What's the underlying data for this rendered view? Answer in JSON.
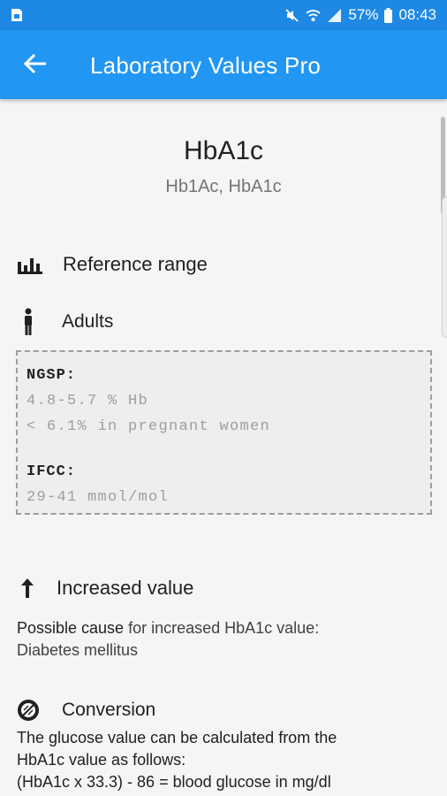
{
  "status_bar": {
    "battery": "57%",
    "time": "08:43",
    "icons": [
      "sim-icon",
      "mute-icon",
      "wifi-icon",
      "signal-icon",
      "battery-icon"
    ]
  },
  "app_bar": {
    "title": "Laboratory Values Pro",
    "back_icon": "arrow-back-icon"
  },
  "test": {
    "name": "HbA1c",
    "aliases": "Hb1Ac, HbA1c"
  },
  "reference": {
    "heading": "Reference range",
    "group_label": "Adults",
    "ngsp_label": "NGSP:",
    "ngsp_line1": "4.8-5.7 % Hb",
    "ngsp_line2": "< 6.1% in pregnant women",
    "ifcc_label": "IFCC:",
    "ifcc_value": "29-41 mmol/mol"
  },
  "increased": {
    "heading": "Increased value",
    "cause_label": "Possible cause",
    "cause_text": " for increased HbA1c value:",
    "cause_value": "Diabetes mellitus"
  },
  "conversion": {
    "heading": "Conversion",
    "line1": "The glucose value can be calculated from the",
    "line2": "HbA1c value as follows:",
    "line3": "(HbA1c x 33.3) - 86 = blood glucose in mg/dl"
  },
  "colors": {
    "app_bar": "#2196f3",
    "status_bar": "#1e88e5"
  }
}
